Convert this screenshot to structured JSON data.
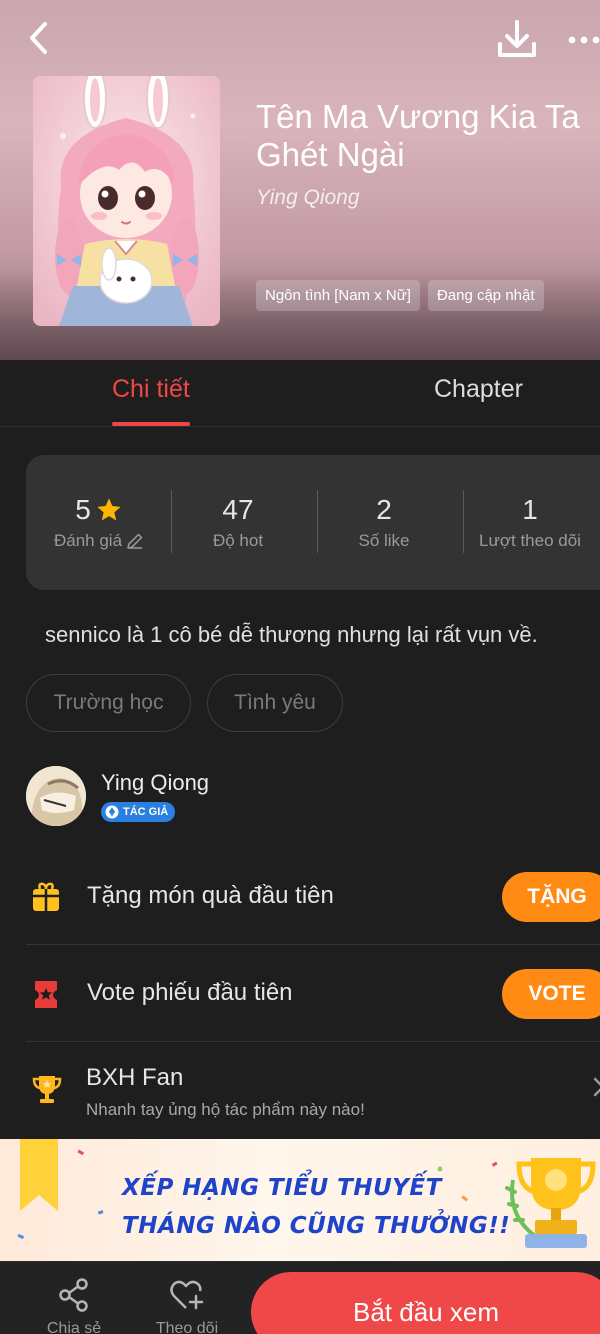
{
  "header": {
    "title": "Tên Ma Vương Kia Ta Ghét Ngài",
    "author": "Ying Qiong",
    "chips": [
      "Ngôn tình [Nam x Nữ]",
      "Đang cập nhật"
    ],
    "icons": {
      "back": "chevron-left-icon",
      "download": "download-icon",
      "more": "more-horizontal-icon"
    }
  },
  "tabs": {
    "detail": "Chi tiết",
    "chapter": "Chapter",
    "active": "detail",
    "active_color": "#ef4747"
  },
  "stats": [
    {
      "value": "5",
      "label": "Đánh giá"
    },
    {
      "value": "47",
      "label": "Độ hot"
    },
    {
      "value": "2",
      "label": "Số like"
    },
    {
      "value": "1",
      "label": "Lượt theo dõi"
    }
  ],
  "description": "sennico là 1 cô bé dễ thương nhưng lại rất vụn về.",
  "genres": [
    "Trường học",
    "Tình yêu"
  ],
  "author_card": {
    "name": "Ying Qiong",
    "badge": "TÁC GIẢ"
  },
  "actions": {
    "gift": {
      "label": "Tặng món quà đầu tiên",
      "button": "TẶNG"
    },
    "vote": {
      "label": "Vote phiếu đầu tiên",
      "button": "VOTE"
    },
    "accent_color": "#ff8a14"
  },
  "fan_ranking": {
    "title": "BXH Fan",
    "subtitle": "Nhanh tay ủng hộ tác phẩm này nào!"
  },
  "banner": {
    "line1": "XẾP HẠNG TIỂU THUYẾT",
    "line2": "THÁNG NÀO CŨNG THƯỞNG!!"
  },
  "bottom_bar": {
    "share": "Chia sẻ",
    "follow": "Theo dõi",
    "start": "Bắt đầu xem",
    "start_color": "#f04848"
  }
}
